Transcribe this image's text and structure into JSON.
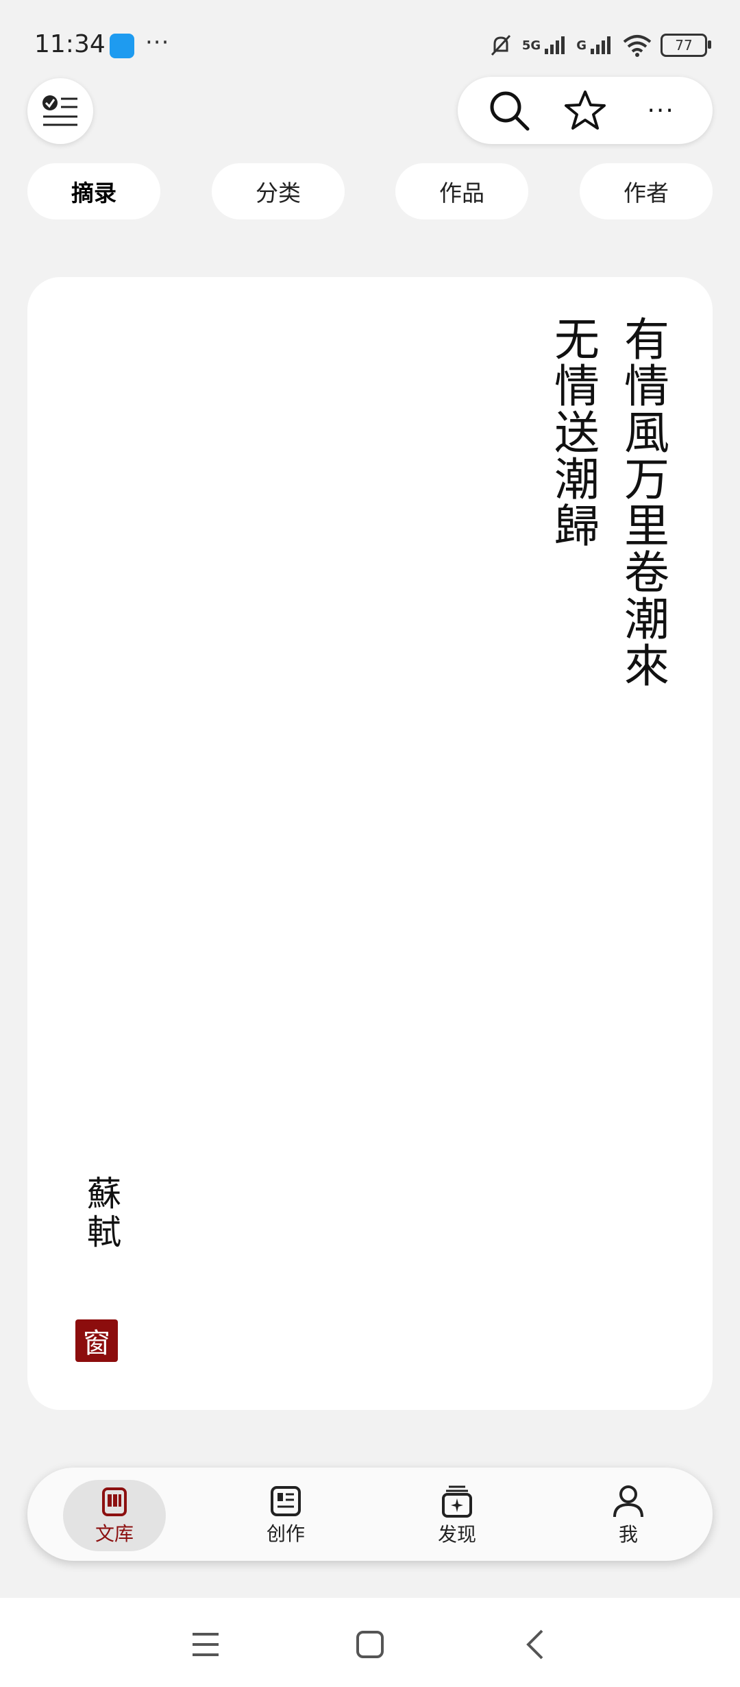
{
  "status_bar": {
    "time": "11:34",
    "more": "···",
    "signal_1": "5G",
    "signal_2": "G",
    "battery": "77"
  },
  "header": {
    "menu_icon": "checklist-icon",
    "actions": [
      {
        "name": "search",
        "icon": "search-icon"
      },
      {
        "name": "favorite",
        "icon": "star-icon"
      },
      {
        "name": "more",
        "icon": "more-icon",
        "label": "···"
      }
    ]
  },
  "tabs": [
    {
      "label": "摘录",
      "active": true
    },
    {
      "label": "分类",
      "active": false
    },
    {
      "label": "作品",
      "active": false
    },
    {
      "label": "作者",
      "active": false
    }
  ],
  "card": {
    "lines": [
      "有情風万里卷潮來",
      "无情送潮歸"
    ],
    "author": "蘇軾",
    "seal": "窗"
  },
  "bottom_nav": [
    {
      "label": "文库",
      "icon": "library-icon",
      "active": true
    },
    {
      "label": "创作",
      "icon": "create-icon",
      "active": false
    },
    {
      "label": "发现",
      "icon": "discover-icon",
      "active": false
    },
    {
      "label": "我",
      "icon": "profile-icon",
      "active": false
    }
  ],
  "colors": {
    "accent": "#8c1010",
    "seal": "#8c0d0d",
    "background": "#f2f2f2"
  }
}
